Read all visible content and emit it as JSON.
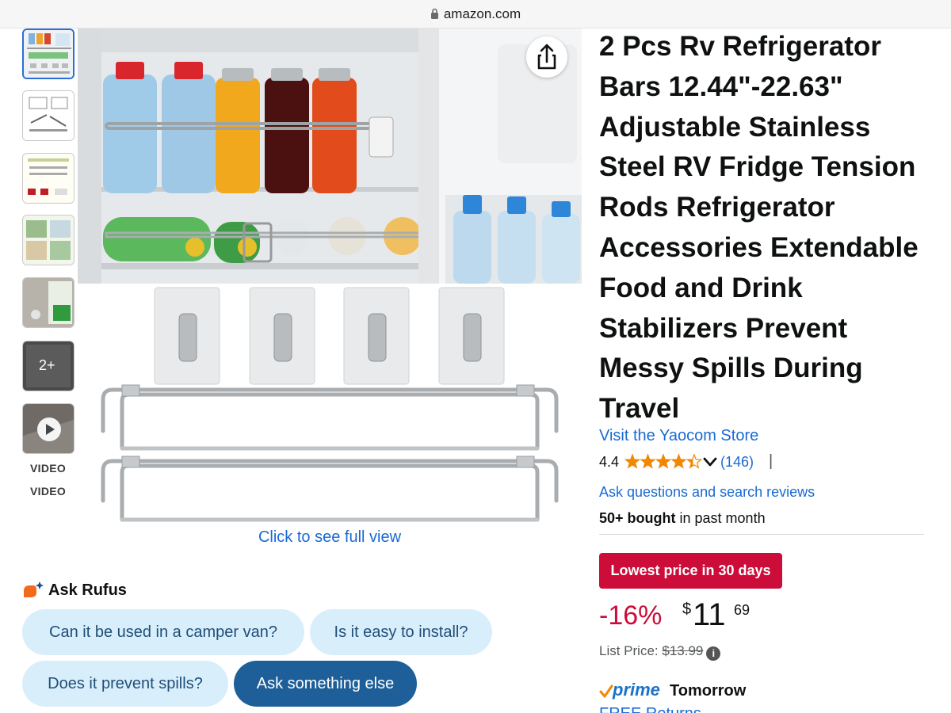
{
  "browser": {
    "url": "amazon.com"
  },
  "gallery": {
    "thumbnails": [
      {
        "name": "thumb-fridge"
      },
      {
        "name": "thumb-diagram"
      },
      {
        "name": "thumb-sizes"
      },
      {
        "name": "thumb-uses"
      },
      {
        "name": "thumb-install"
      },
      {
        "name": "thumb-more",
        "label": "2+"
      },
      {
        "name": "thumb-video"
      }
    ],
    "video_labels": [
      "VIDEO",
      "VIDEO"
    ],
    "full_view_link": "Click to see full view"
  },
  "rufus": {
    "title": "Ask Rufus",
    "chips": [
      "Can it be used in a camper van?",
      "Is it easy to install?",
      "Does it prevent spills?",
      "Ask something else"
    ]
  },
  "product": {
    "title_lines": [
      "2 Pcs Rv Refrigerator",
      "Bars 12.44\"-22.63\"",
      "Adjustable Stainless",
      "Steel RV Fridge Tension",
      "Rods Refrigerator",
      "Accessories Extendable",
      "Food and Drink",
      "Stabilizers Prevent",
      "Messy Spills During",
      "Travel"
    ],
    "store_link": "Visit the Yaocom Store",
    "rating": "4.4",
    "rating_value": 4.4,
    "rating_count": "(146)",
    "rating_separator": "|",
    "ask_link": "Ask questions and search reviews",
    "bought_bold": "50+ bought",
    "bought_rest": " in past month",
    "deal_badge": "Lowest price in 30 days",
    "discount": "-16%",
    "price_symbol": "$",
    "price_whole": "11",
    "price_fraction": "69",
    "list_price_label": "List Price: ",
    "list_price": "$13.99",
    "info_icon": "i",
    "prime_label": "prime",
    "delivery": "Tomorrow",
    "free_returns_partial": "FREE Returns"
  },
  "colors": {
    "link": "#1a6ad3",
    "deal": "#cc0c39",
    "star": "#f08804",
    "chip_light": "#d9eefb",
    "chip_dark": "#1f5f99",
    "prime_check": "#f08804"
  }
}
